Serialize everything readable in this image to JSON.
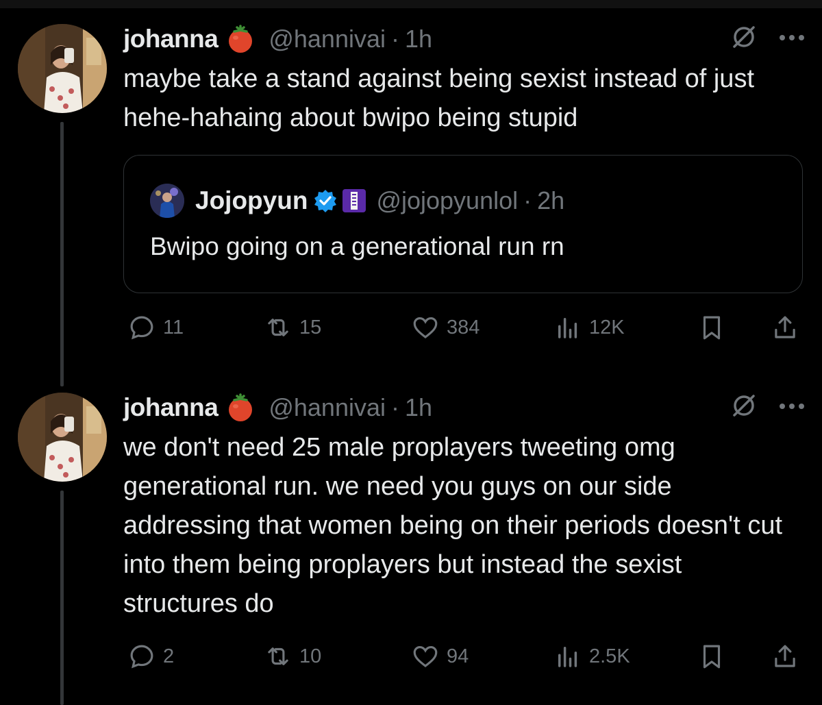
{
  "tweets": [
    {
      "author_name": "johanna",
      "author_emoji": "tomato-emoji",
      "handle": "@hannivai",
      "separator": "·",
      "time": "1h",
      "text": "maybe take a stand against being sexist instead of just hehe-hahaing about bwipo being stupid",
      "quote": {
        "author_name": "Jojopyun",
        "verified": true,
        "affiliate_badge": "team-badge",
        "handle": "@jojopyunlol",
        "separator": "·",
        "time": "2h",
        "text": "Bwipo going on a generational run rn"
      },
      "stats": {
        "replies": "11",
        "reposts": "15",
        "likes": "384",
        "views": "12K"
      }
    },
    {
      "author_name": "johanna",
      "author_emoji": "tomato-emoji",
      "handle": "@hannivai",
      "separator": "·",
      "time": "1h",
      "text": "we don't need 25 male proplayers tweeting omg generational run. we need you guys on our side addressing that women being on their periods doesn't cut into them being proplayers but instead the sexist structures do",
      "stats": {
        "replies": "2",
        "reposts": "10",
        "likes": "94",
        "views": "2.5K"
      }
    }
  ],
  "colors": {
    "background": "#000000",
    "text_primary": "#e7e9ea",
    "text_secondary": "#71767b",
    "border": "#2f3336",
    "verified": "#1d9bf0"
  }
}
